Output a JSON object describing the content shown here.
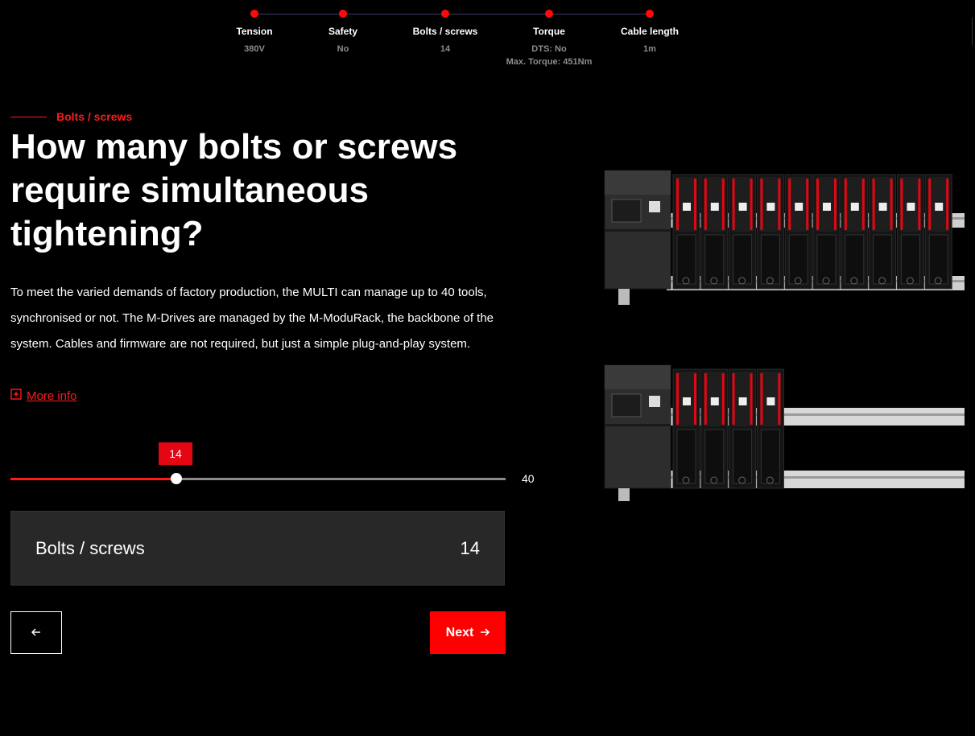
{
  "stepper": {
    "steps": [
      {
        "label": "Tension",
        "value": "380V"
      },
      {
        "label": "Safety",
        "value": "No"
      },
      {
        "label": "Bolts / screws",
        "value": "14"
      },
      {
        "label": "Torque",
        "value": "DTS: No",
        "value2": "Max. Torque: 451Nm"
      },
      {
        "label": "Cable length",
        "value": "1m"
      }
    ]
  },
  "section": {
    "eyebrow": "Bolts / screws",
    "title": "How many bolts or screws require simultaneous tightening?",
    "description": "To meet the varied demands of factory production, the MULTI can manage up to 40 tools, synchronised or not. The M-Drives are managed by the M-ModuRack, the backbone of the system. Cables and firmware are not required, but just a simple plug-and-play system.",
    "more_info": "More info"
  },
  "slider": {
    "value": 14,
    "value_label": "14",
    "max": 40,
    "max_label": "40",
    "fraction": 0.333
  },
  "summary": {
    "label": "Bolts / screws",
    "value": "14"
  },
  "nav": {
    "next_label": "Next",
    "back_icon": "arrow-left-icon",
    "next_icon": "arrow-right-icon"
  },
  "colors": {
    "accent": "#ff0000",
    "accent_dark": "#e30613",
    "panel": "#282828",
    "background": "#000000"
  }
}
